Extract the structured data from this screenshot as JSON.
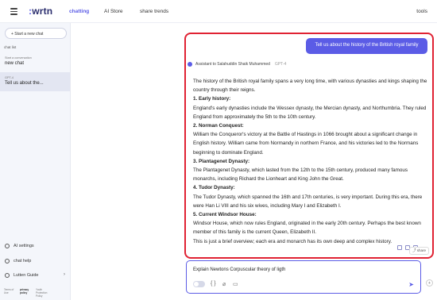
{
  "header": {
    "logo": "wrtn",
    "nav": [
      "chatting",
      "AI Store",
      "share trends"
    ],
    "tools_label": "tools"
  },
  "sidebar": {
    "new_chat_label": "+ Start a new chat",
    "chat_list_label": "chat list",
    "chats": [
      {
        "meta": "Start a conversation",
        "title": "new chat",
        "selected": false
      },
      {
        "meta": "GPT-4",
        "title": "Tell us about the...",
        "selected": true
      }
    ],
    "bottom_items": [
      {
        "icon": "gear-icon",
        "label": "AI settings"
      },
      {
        "icon": "help-icon",
        "label": "chat help"
      },
      {
        "icon": "guide-icon",
        "label": "Lutten Guide"
      }
    ],
    "footer_links": [
      "Terms of Use",
      "privacy policy",
      "Youth Protection Policy"
    ]
  },
  "conversation": {
    "user_message": "Tell us about the history of the British royal family",
    "assistant_label": "Assistant to Salahuddin Shaik Muhammed",
    "model_label": "GPT-4",
    "answer": [
      {
        "type": "text",
        "text": "The history of the British royal family spans a very long time, with various dynasties and kings shaping the country through their reigns."
      },
      {
        "type": "heading",
        "text": "1. Early history:"
      },
      {
        "type": "text",
        "text": "England's early dynasties include the Wessex dynasty, the Mercian dynasty, and Northumbria. They ruled England from approximately the 5th to the 10th century."
      },
      {
        "type": "heading",
        "text": "2. Norman Conquest:"
      },
      {
        "type": "text",
        "text": "William the Conqueror's victory at the Battle of Hastings in 1066 brought about a significant change in English history. William came from Normandy in northern France, and his victories led to the Normans beginning to dominate England."
      },
      {
        "type": "heading",
        "text": "3. Plantagenet Dynasty:"
      },
      {
        "type": "text",
        "text": "The Plantagenet Dynasty, which lasted from the 12th to the 15th century, produced many famous monarchs, including Richard the Lionheart and King John the Great."
      },
      {
        "type": "heading",
        "text": "4. Tudor Dynasty:"
      },
      {
        "type": "text",
        "text": "The Tudor Dynasty, which spanned the 16th and 17th centuries, is very important. During this era, there were Han Li VIII and his six wives, including Mary I and Elizabeth I."
      },
      {
        "type": "heading",
        "text": "5. Current Windsor House:"
      },
      {
        "type": "text",
        "text": "Windsor House, which now rules England, originated in the early 20th century. Perhaps the best known member of this family is the current Queen, Elizabeth II."
      },
      {
        "type": "text",
        "text": "This is just a brief overview; each era and monarch has its own deep and complex history."
      }
    ],
    "share_label": "share"
  },
  "composer": {
    "text": "Explain Newtons Corpuscular theory of ligth",
    "send_icon": "send-icon"
  },
  "colors": {
    "accent": "#5b5ce6",
    "highlight_border": "#e02233"
  }
}
